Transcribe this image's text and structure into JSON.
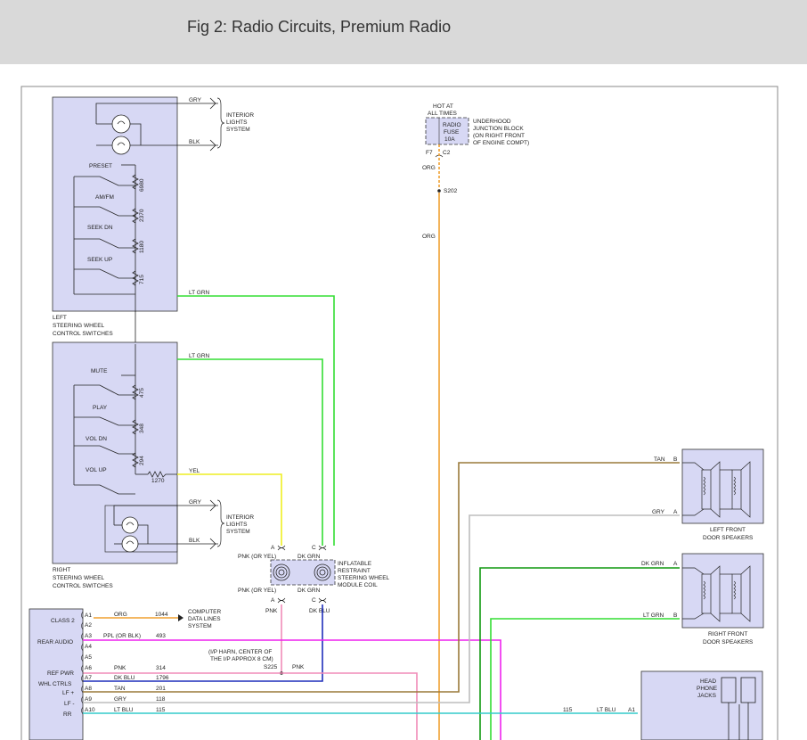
{
  "page_title": "Fig 2: Radio Circuits, Premium Radio",
  "colors": {
    "panel_fill": "#d7d8f4",
    "lt_grn": "#33dd33",
    "yel": "#eeee22",
    "org": "#f0a030",
    "pnk": "#f08cb8",
    "dk_blu": "#1f2fbb",
    "tan": "#9a7a3a",
    "gry": "#bdbdbd",
    "dk_grn": "#119911",
    "magenta": "#ee22ee",
    "lt_blu": "#33cccc"
  },
  "left_switch": {
    "title_lines": [
      "LEFT",
      "STEERING WHEEL",
      "CONTROL SWITCHES"
    ],
    "buttons": [
      "PRESET",
      "AM/FM",
      "SEEK DN",
      "SEEK UP"
    ],
    "resistors": [
      "6980",
      "2370",
      "1180",
      "715"
    ],
    "out_wire": "LT GRN",
    "light_wires": [
      "GRY",
      "BLK"
    ],
    "light_label": [
      "INTERIOR",
      "LIGHTS",
      "SYSTEM"
    ]
  },
  "right_switch": {
    "title_lines": [
      "RIGHT",
      "STEERING WHEEL",
      "CONTROL SWITCHES"
    ],
    "buttons": [
      "MUTE",
      "PLAY",
      "VOL DN",
      "VOL UP"
    ],
    "resistors": [
      "475",
      "348",
      "294"
    ],
    "series_resistor": "1270",
    "out_wires": [
      "LT GRN",
      "YEL"
    ],
    "light_wires": [
      "GRY",
      "BLK"
    ],
    "light_label": [
      "INTERIOR",
      "LIGHTS",
      "SYSTEM"
    ]
  },
  "fuse": {
    "hot_label": [
      "HOT AT",
      "ALL TIMES"
    ],
    "name": [
      "RADIO",
      "FUSE",
      "10A"
    ],
    "block_label": [
      "UNDERHOOD",
      "JUNCTION BLOCK",
      "(ON RIGHT FRONT",
      "OF ENGINE COMPT)"
    ],
    "pins": [
      "F7",
      "C2"
    ],
    "wire": "ORG",
    "splice": "S202"
  },
  "coil": {
    "label": [
      "INFLATABLE",
      "RESTRAINT",
      "STEERING WHEEL",
      "MODULE COIL"
    ],
    "pin_top": [
      "A",
      "C"
    ],
    "top_wires": [
      "PNK (OR YEL)",
      "DK GRN"
    ],
    "bottom_wires": [
      "PNK (OR YEL)",
      "DK GRN"
    ],
    "pin_bottom": [
      "A",
      "C"
    ],
    "out_wires": [
      "PNK",
      "DK BLU"
    ]
  },
  "splice_s225": {
    "note": [
      "(I/P HARN, CENTER OF",
      "THE I/P APPROX 8 CM)"
    ],
    "name": "S225",
    "wire": "PNK"
  },
  "radio": {
    "labels": [
      "CLASS 2",
      "REAR AUDIO",
      "REF PWR",
      "WHL CTRLS",
      "LF +",
      "LF -",
      "RR"
    ],
    "pins": [
      "A1",
      "A2",
      "A3",
      "A4",
      "A5",
      "A6",
      "A7",
      "A8",
      "A9",
      "A10"
    ],
    "wire_colors": [
      "ORG",
      "",
      "PPL (OR BLK)",
      "",
      "",
      "PNK",
      "DK BLU",
      "TAN",
      "GRY",
      "LT BLU"
    ],
    "circuits": [
      "1044",
      "",
      "493",
      "",
      "",
      "314",
      "1796",
      "201",
      "118",
      "115"
    ],
    "data_lines_label": [
      "COMPUTER",
      "DATA LINES",
      "SYSTEM"
    ]
  },
  "left_front_speakers": {
    "label": [
      "LEFT FRONT",
      "DOOR SPEAKERS"
    ],
    "wires": [
      "TAN",
      "GRY"
    ],
    "pins": [
      "B",
      "A"
    ]
  },
  "right_front_speakers": {
    "label": [
      "RIGHT FRONT",
      "DOOR SPEAKERS"
    ],
    "wires": [
      "DK GRN",
      "LT GRN"
    ],
    "pins": [
      "A",
      "B"
    ]
  },
  "headphone": {
    "label": [
      "HEAD",
      "PHONE",
      "JACKS"
    ],
    "wire": "LT BLU",
    "circuit": "115",
    "pin": "A1"
  }
}
